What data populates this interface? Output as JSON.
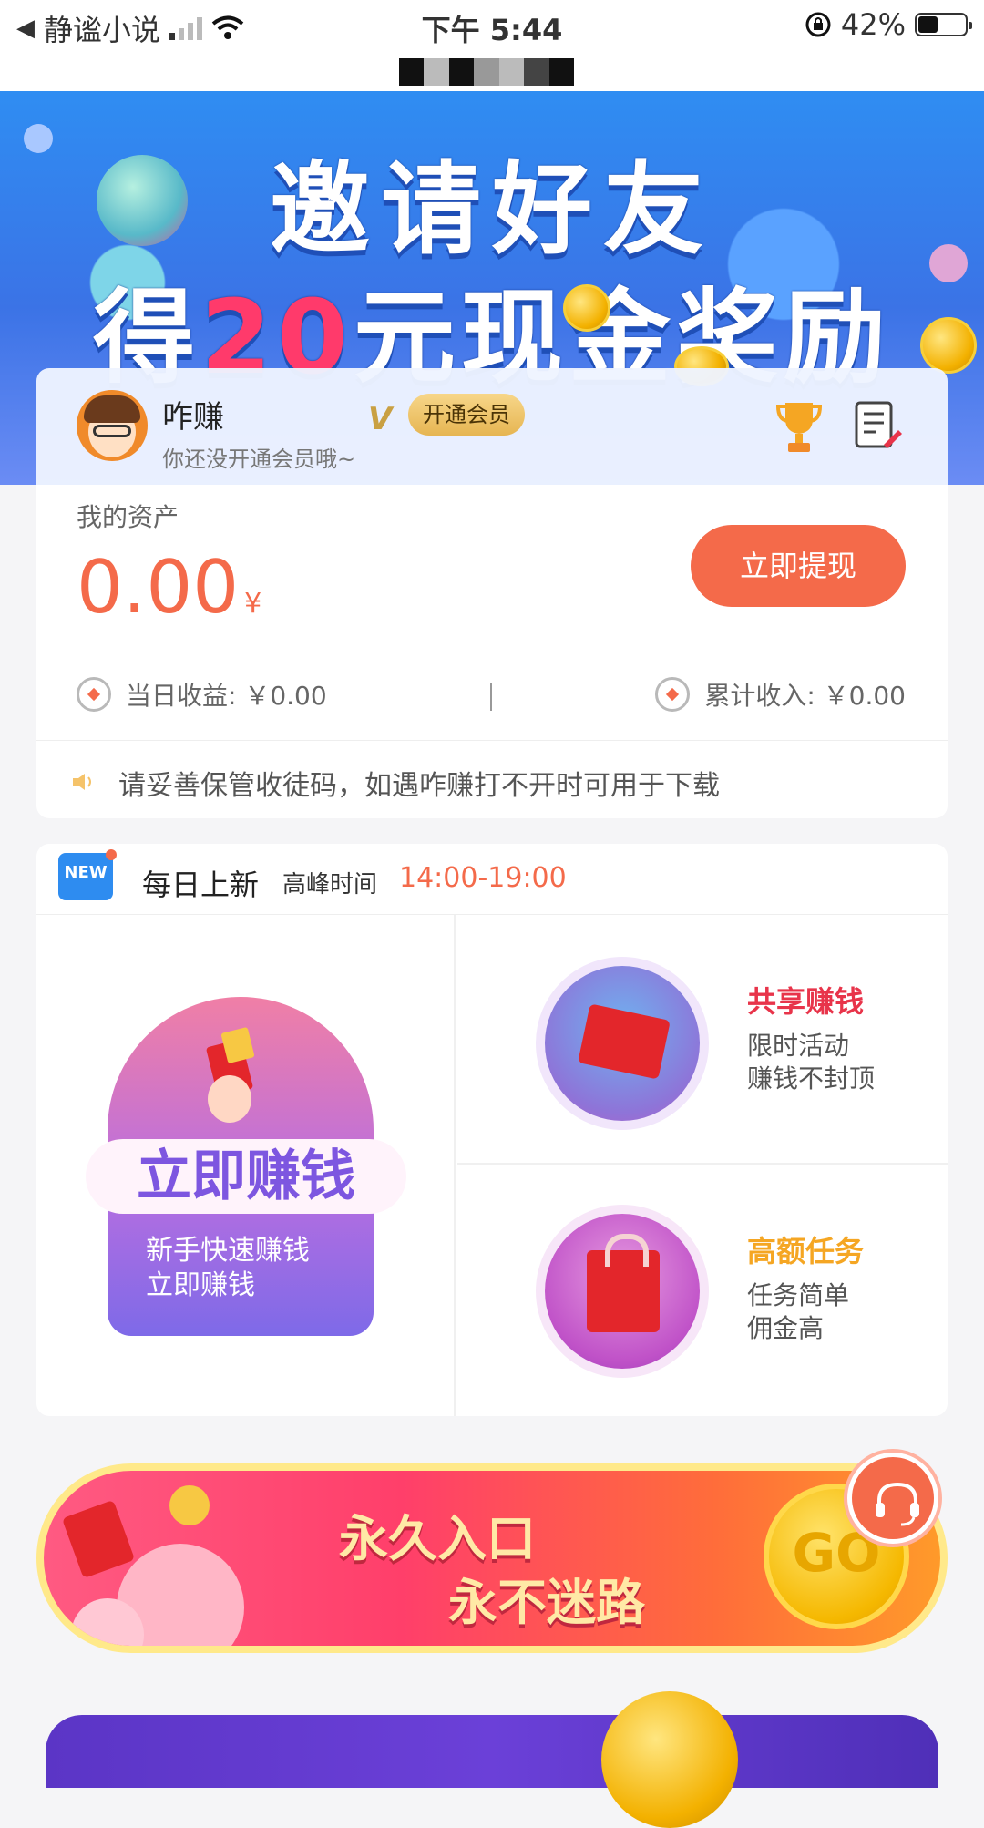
{
  "status_bar": {
    "back_app": "静谧小说",
    "time": "下午 5:44",
    "battery_percent": "42%",
    "battery_level": 0.42
  },
  "banner": {
    "line1": "邀请好友",
    "line2_prefix": "得",
    "line2_number": "20",
    "line2_suffix": "元现金奖励"
  },
  "user": {
    "name": "咋赚",
    "subtitle": "你还没开通会员哦~",
    "vip_mark": "V",
    "vip_button": "开通会员"
  },
  "assets": {
    "label": "我的资产",
    "amount": "0.00",
    "unit": "¥",
    "withdraw_button": "立即提现",
    "today_earnings": "当日收益: ￥0.00",
    "total_income": "累计收入: ￥0.00",
    "notice": "请妥善保管收徒码，如遇咋赚打不开时可用于下载"
  },
  "daily": {
    "badge": "NEW",
    "title": "每日上新",
    "peak_label": "高峰时间",
    "peak_time": "14:00-19:00",
    "earn_now": {
      "title": "立即赚钱",
      "sub1": "新手快速赚钱",
      "sub2": "立即赚钱"
    },
    "share": {
      "title": "共享赚钱",
      "sub1": "限时活动",
      "sub2": "赚钱不封顶"
    },
    "task": {
      "title": "高额任务",
      "sub1": "任务简单",
      "sub2": "佣金高"
    }
  },
  "promo": {
    "line1": "永久入口",
    "line2": "永不迷路",
    "go": "GO"
  },
  "colors": {
    "accent": "#f46a4a",
    "share_title": "#e8344a",
    "task_title": "#f5a623"
  }
}
